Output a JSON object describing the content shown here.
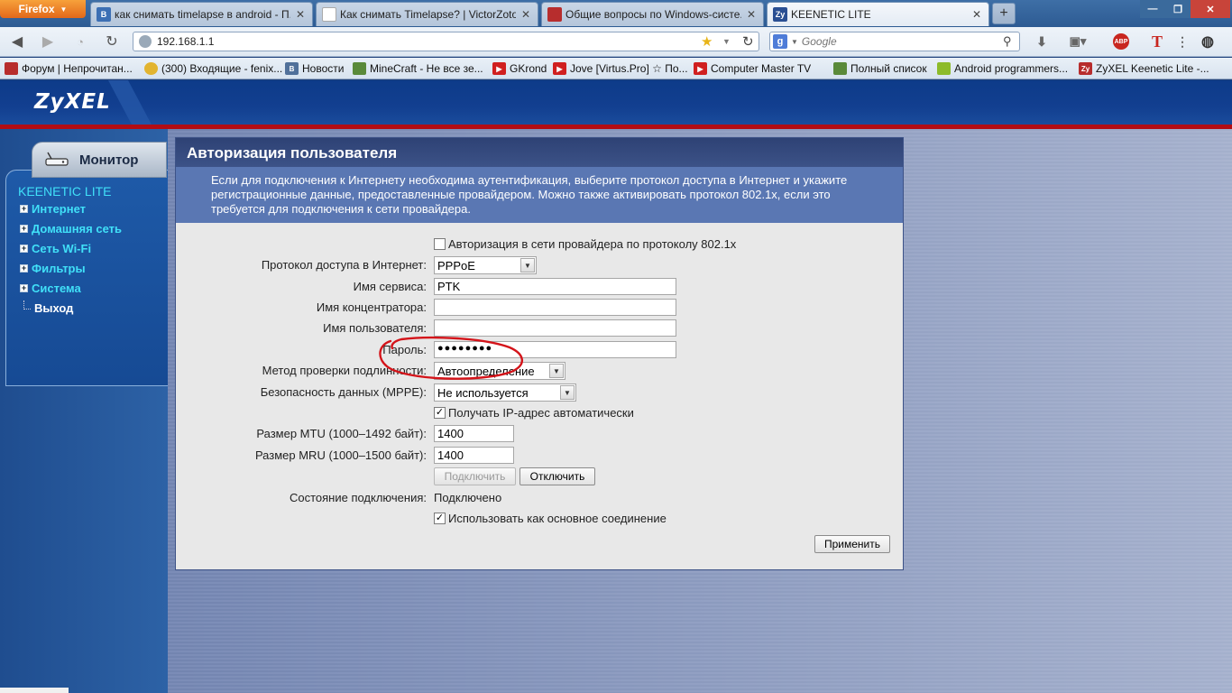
{
  "browser": {
    "menu_button": "Firefox",
    "tabs": [
      {
        "title": "как снимать timelapse в android - П..."
      },
      {
        "title": "Как снимать Timelapse? | VictorZoto..."
      },
      {
        "title": "Общие вопросы по Windows-систе..."
      },
      {
        "title": "KEENETIC LITE"
      }
    ],
    "url": "192.168.1.1",
    "search_placeholder": "Google",
    "addon_abp": "ABP",
    "bookmarks": [
      "Форум | Непрочитан...",
      "(300) Входящие - fenix...",
      "Новости",
      "MineCraft - Не все зе...",
      "GKrond",
      "Jove [Virtus.Pro] ☆ По...",
      "Computer Master TV",
      "Полный список",
      "Android programmers...",
      "ZyXEL Keenetic Lite -..."
    ]
  },
  "router": {
    "logo": "ZyXEL",
    "monitor_tab": "Монитор",
    "model": "KEENETIC LITE",
    "menu": [
      "Интернет",
      "Домашняя сеть",
      "Сеть Wi-Fi",
      "Фильтры",
      "Система"
    ],
    "exit": "Выход",
    "panel": {
      "title": "Авторизация пользователя",
      "description": "Если для подключения к Интернету необходима аутентификация, выберите протокол доступа в Интернет и укажите регистрационные данные, предоставленные провайдером. Можно также активировать протокол 802.1x, если это требуется для подключения к сети провайдера.",
      "auth_8021x_label": "Авторизация в сети провайдера по протоколу 802.1x",
      "auth_8021x_checked": false,
      "protocol_label": "Протокол доступа в Интернет:",
      "protocol_value": "PPPoE",
      "service_label": "Имя сервиса:",
      "service_value": "PTK",
      "concentrator_label": "Имя концентратора:",
      "concentrator_value": "",
      "username_label": "Имя пользователя:",
      "username_value": "",
      "password_label": "Пароль:",
      "password_value": "●●●●●●●●",
      "auth_method_label": "Метод проверки подлинности:",
      "auth_method_value": "Автоопределение",
      "mppe_label": "Безопасность данных (MPPE):",
      "mppe_value": "Не используется",
      "auto_ip_label": "Получать IP-адрес автоматически",
      "auto_ip_checked": true,
      "mtu_label": "Размер MTU (1000–1492 байт):",
      "mtu_value": "1400",
      "mru_label": "Размер MRU (1000–1500 байт):",
      "mru_value": "1400",
      "connect_button": "Подключить",
      "disconnect_button": "Отключить",
      "status_label": "Состояние подключения:",
      "status_value": "Подключено",
      "primary_label": "Использовать как основное соединение",
      "primary_checked": true,
      "apply_button": "Применить"
    }
  },
  "colors": {
    "header_blue": "#123f90",
    "accent_red": "#b20d14",
    "menu_cyan": "#40e0f8",
    "annotation_red": "#d4141a"
  }
}
